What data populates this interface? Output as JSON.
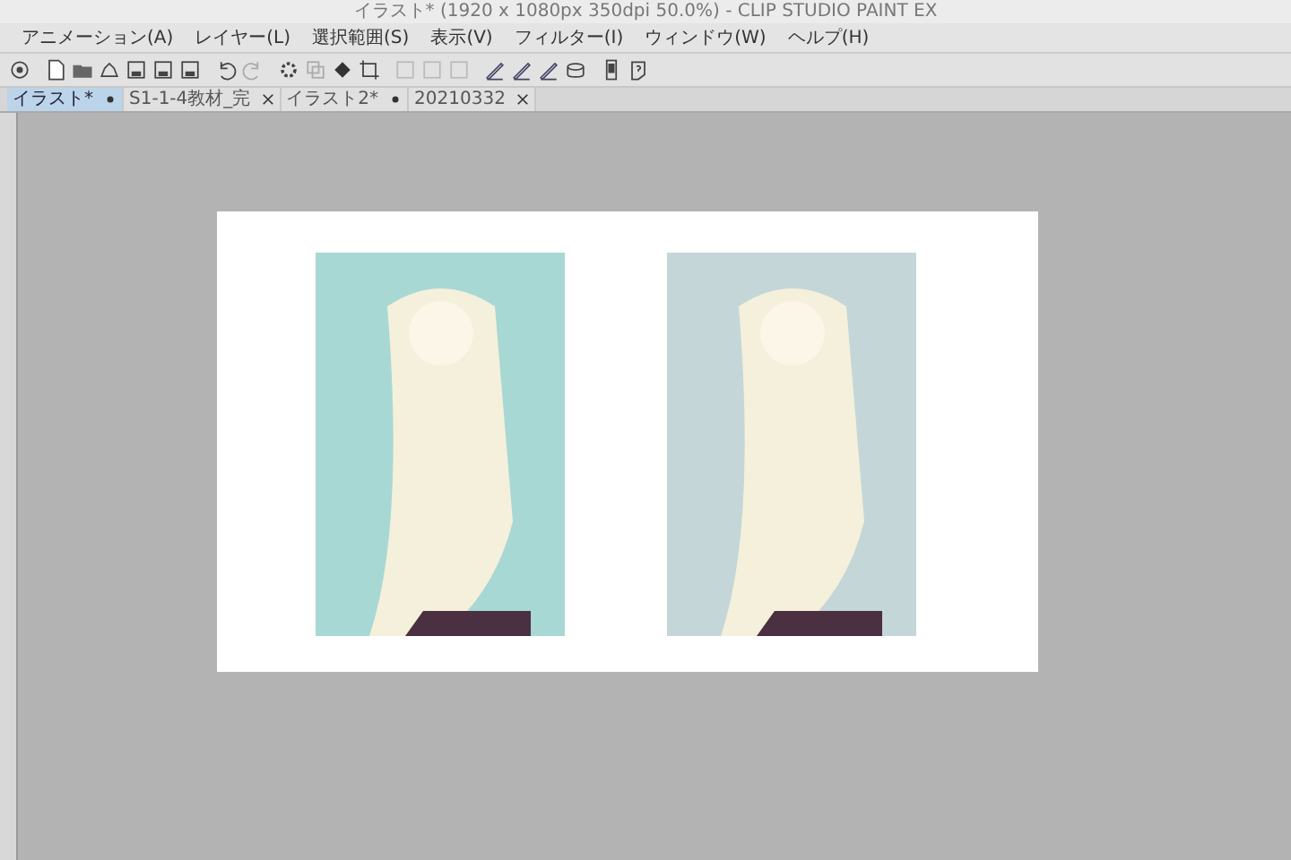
{
  "window": {
    "title": "イラスト* (1920 x 1080px 350dpi 50.0%) - CLIP STUDIO PAINT EX"
  },
  "menu": [
    "アニメーション(A)",
    "レイヤー(L)",
    "選択範囲(S)",
    "表示(V)",
    "フィルター(I)",
    "ウィンドウ(W)",
    "ヘルプ(H)"
  ],
  "toolbar": [
    {
      "kind": "app"
    },
    {
      "kind": "sep"
    },
    {
      "kind": "new"
    },
    {
      "kind": "open"
    },
    {
      "kind": "cloud"
    },
    {
      "kind": "save"
    },
    {
      "kind": "save"
    },
    {
      "kind": "save"
    },
    {
      "kind": "sep"
    },
    {
      "kind": "undo"
    },
    {
      "kind": "redo"
    },
    {
      "kind": "sep"
    },
    {
      "kind": "gear"
    },
    {
      "kind": "copy"
    },
    {
      "kind": "fill"
    },
    {
      "kind": "crop"
    },
    {
      "kind": "sep"
    },
    {
      "kind": "square"
    },
    {
      "kind": "square"
    },
    {
      "kind": "square"
    },
    {
      "kind": "sep"
    },
    {
      "kind": "pen"
    },
    {
      "kind": "pen"
    },
    {
      "kind": "pen"
    },
    {
      "kind": "stack"
    },
    {
      "kind": "sep"
    },
    {
      "kind": "phone"
    },
    {
      "kind": "help"
    }
  ],
  "tabs": [
    {
      "label": "イラスト*",
      "selected": true,
      "modified": true
    },
    {
      "label": "S1-1-4教材_完",
      "selected": false,
      "modified": false
    },
    {
      "label": "イラスト2*",
      "selected": false,
      "modified": true
    },
    {
      "label": "20210332",
      "selected": false,
      "modified": false
    }
  ],
  "canvas": {
    "illustrations": [
      {
        "color": "#a8d8d4"
      },
      {
        "color": "#c4d6d8"
      }
    ]
  }
}
